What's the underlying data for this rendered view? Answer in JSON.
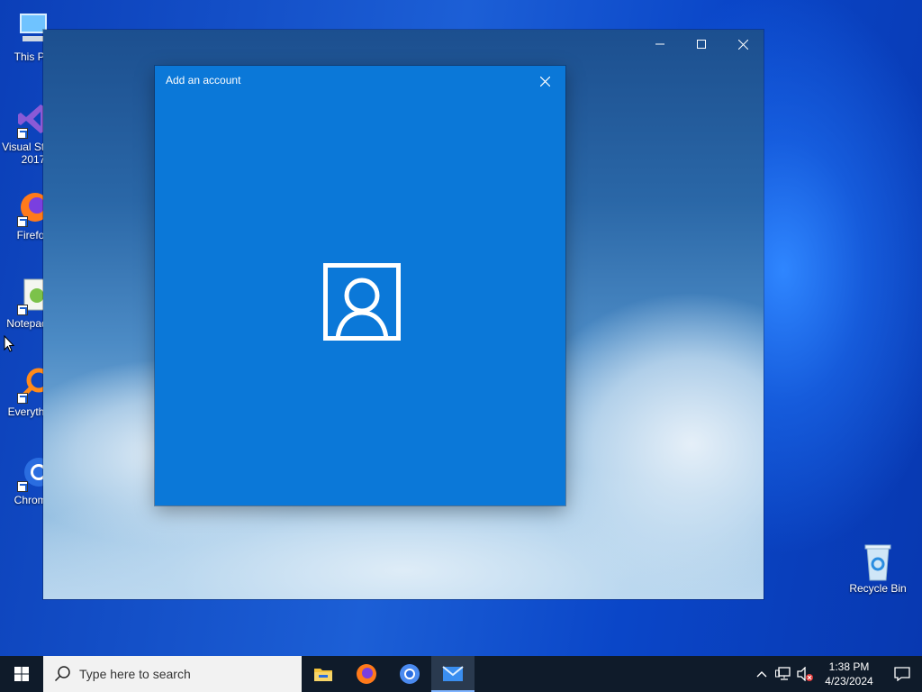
{
  "desktop": {
    "icons": [
      {
        "label": "This PC",
        "icon": "computer-icon"
      },
      {
        "label": "Visual Studio 2017",
        "icon": "visual-studio-icon"
      },
      {
        "label": "Firefox",
        "icon": "firefox-icon"
      },
      {
        "label": "Notepad++",
        "icon": "notepad-plus-icon"
      },
      {
        "label": "Everything",
        "icon": "everything-search-icon"
      },
      {
        "label": "Chrome",
        "icon": "chrome-icon"
      }
    ],
    "recycle_bin": {
      "label": "Recycle Bin",
      "icon": "recycle-bin-icon"
    }
  },
  "dialog": {
    "title": "Add an account",
    "icon": "person-icon"
  },
  "taskbar": {
    "search_placeholder": "Type here to search",
    "apps": [
      {
        "name": "File Explorer",
        "icon": "file-explorer-icon"
      },
      {
        "name": "Firefox",
        "icon": "firefox-icon"
      },
      {
        "name": "Chrome",
        "icon": "chrome-icon"
      },
      {
        "name": "Mail",
        "icon": "mail-icon",
        "active": true
      }
    ],
    "clock": {
      "time": "1:38 PM",
      "date": "4/23/2024"
    }
  },
  "colors": {
    "dialog_bg": "#0b78d8",
    "taskbar_bg": "#0f1b2a",
    "desktop_bg": "#1c5fd6"
  }
}
